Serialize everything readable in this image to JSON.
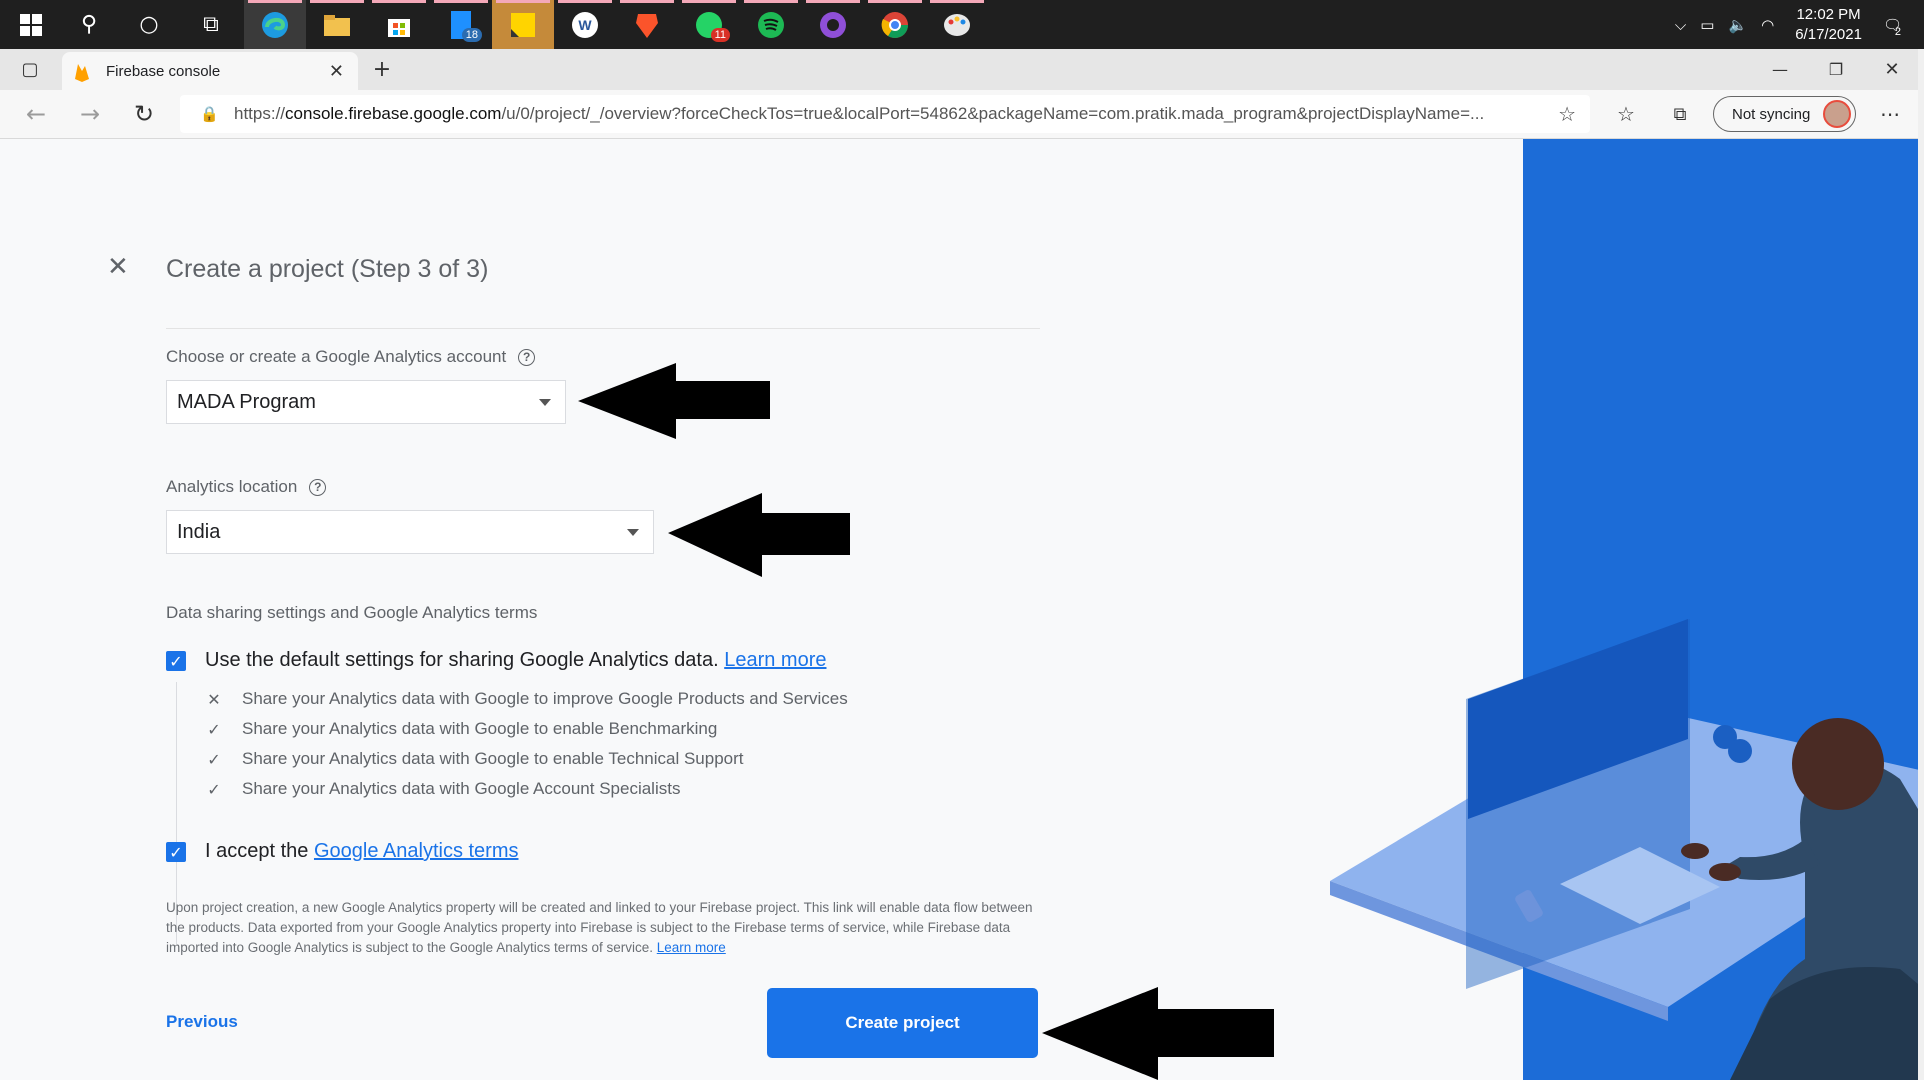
{
  "taskbar": {
    "badges": {
      "files": "18",
      "whatsapp": "11"
    },
    "clock_time": "12:02 PM",
    "clock_date": "6/17/2021",
    "notifications": "2"
  },
  "browser": {
    "tab_title": "Firebase console",
    "url_prefix": "https://",
    "url_host": "console.firebase.google.com",
    "url_rest": "/u/0/project/_/overview?forceCheckTos=true&localPort=54862&packageName=com.pratik.mada_program&projectDisplayName=...",
    "sync_label": "Not syncing"
  },
  "page": {
    "heading": "Create a project (Step 3 of 3)",
    "analytics_account_label": "Choose or create a Google Analytics account",
    "analytics_account_value": "MADA Program",
    "location_label": "Analytics location",
    "location_value": "India",
    "data_sharing_label": "Data sharing settings and Google Analytics terms",
    "default_settings_text": "Use the default settings for sharing Google Analytics data.",
    "learn_more": "Learn more",
    "sharing_items": [
      {
        "mark": "✕",
        "text": "Share your Analytics data with Google to improve Google Products and Services"
      },
      {
        "mark": "✓",
        "text": "Share your Analytics data with Google to enable Benchmarking"
      },
      {
        "mark": "✓",
        "text": "Share your Analytics data with Google to enable Technical Support"
      },
      {
        "mark": "✓",
        "text": "Share your Analytics data with Google Account Specialists"
      }
    ],
    "accept_text": "I accept the ",
    "accept_link": "Google Analytics terms",
    "fine_print": "Upon project creation, a new Google Analytics property will be created and linked to your Firebase project. This link will enable data flow between the products. Data exported from your Google Analytics property into Firebase is subject to the Firebase terms of service, while Firebase data imported into Google Analytics is subject to the Google Analytics terms of service.",
    "fine_learn_more": "Learn more",
    "previous_label": "Previous",
    "create_label": "Create project"
  },
  "colors": {
    "accent": "#1a73e8",
    "illustration_blue": "#1e6fdc"
  }
}
